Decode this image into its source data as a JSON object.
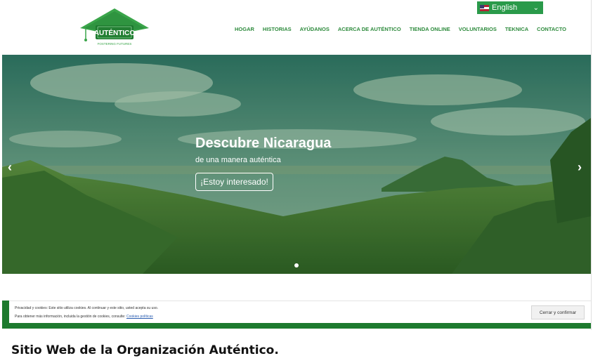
{
  "header": {
    "logo_text": "AUTÉNTICO",
    "logo_tagline": "FOSTERING FUTURES",
    "language": "English",
    "nav": [
      "HOGAR",
      "HISTORIAS",
      "AYÚDANOS",
      "ACERCA DE AUTÉNTICO",
      "TIENDA ONLINE",
      "VOLUNTARIOS",
      "TEKNICA",
      "CONTACTO"
    ]
  },
  "hero": {
    "title": "Descubre Nicaragua",
    "subtitle": "de una manera auténtica",
    "button": "¡Estoy interesado!",
    "prev_arrow": "‹",
    "next_arrow": "›"
  },
  "cookie": {
    "line1": "Privacidad y cookies: Este sitio utiliza cookies. Al continuar y este sitio, usted acepta su uso.",
    "line2": "Para obtener más información, incluida la gestión de cookies, consulte:",
    "link": "Cookies políticas",
    "button": "Cerrar y confirmar"
  },
  "caption": "Sitio Web de la Organización Auténtico.",
  "colors": {
    "brand_green": "#2e8b3d",
    "dark_green": "#1d7a2e",
    "language_bg": "#2a9a4a"
  }
}
